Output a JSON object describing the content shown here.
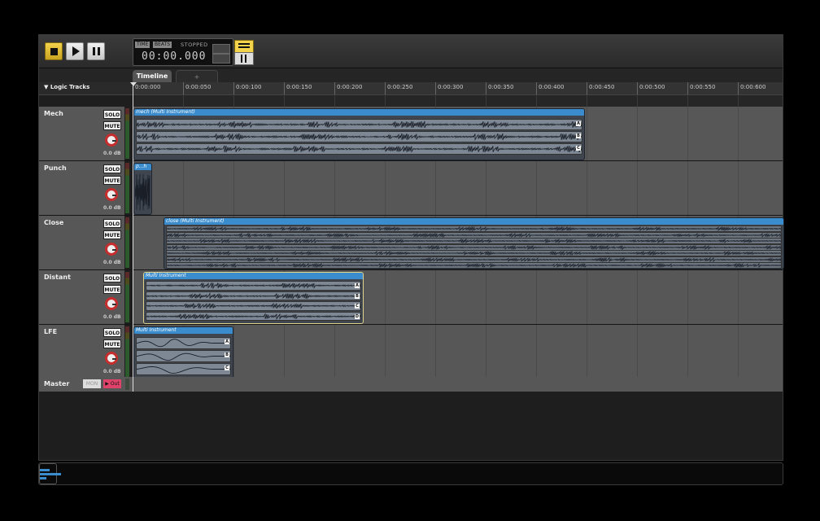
{
  "transport": {
    "stop_icon": "stop-icon",
    "play_icon": "play-icon",
    "pause_icon": "pause-icon",
    "time_tag": "TIME",
    "beats_tag": "BEATS",
    "status": "STOPPED",
    "time": "00:00.000"
  },
  "tabs": {
    "active": "Timeline",
    "add": "+"
  },
  "ruler": {
    "tracks_label": "▼ Logic Tracks",
    "ticks": [
      "0:00:000",
      "0:00:050",
      "0:00:100",
      "0:00:150",
      "0:00:200",
      "0:00:250",
      "0:00:300",
      "0:00:350",
      "0:00:400",
      "0:00:450",
      "0:00:500",
      "0:00:550",
      "0:00:600"
    ]
  },
  "tracks": [
    {
      "name": "Mech",
      "solo": "SOLO",
      "mute": "MUTE",
      "db": "0.0 dB",
      "clip": "mech (Multi Instrument)",
      "channels": [
        "A",
        "B",
        "C"
      ]
    },
    {
      "name": "Punch",
      "solo": "SOLO",
      "mute": "MUTE",
      "db": "0.0 dB",
      "clip": "p...h",
      "channels": []
    },
    {
      "name": "Close",
      "solo": "SOLO",
      "mute": "MUTE",
      "db": "0.0 dB",
      "clip": "close (Multi Instrument)",
      "channels": []
    },
    {
      "name": "Distant",
      "solo": "SOLO",
      "mute": "MUTE",
      "db": "0.0 dB",
      "clip": "Multi Instrument",
      "channels": [
        "A",
        "B",
        "C",
        "D"
      ]
    },
    {
      "name": "LFE",
      "solo": "SOLO",
      "mute": "MUTE",
      "db": "0.0 dB",
      "clip": "Multi Instrument",
      "channels": [
        "A",
        "B",
        "C"
      ]
    }
  ],
  "master": {
    "name": "Master",
    "mon": "MON",
    "out": "▶ Out"
  }
}
